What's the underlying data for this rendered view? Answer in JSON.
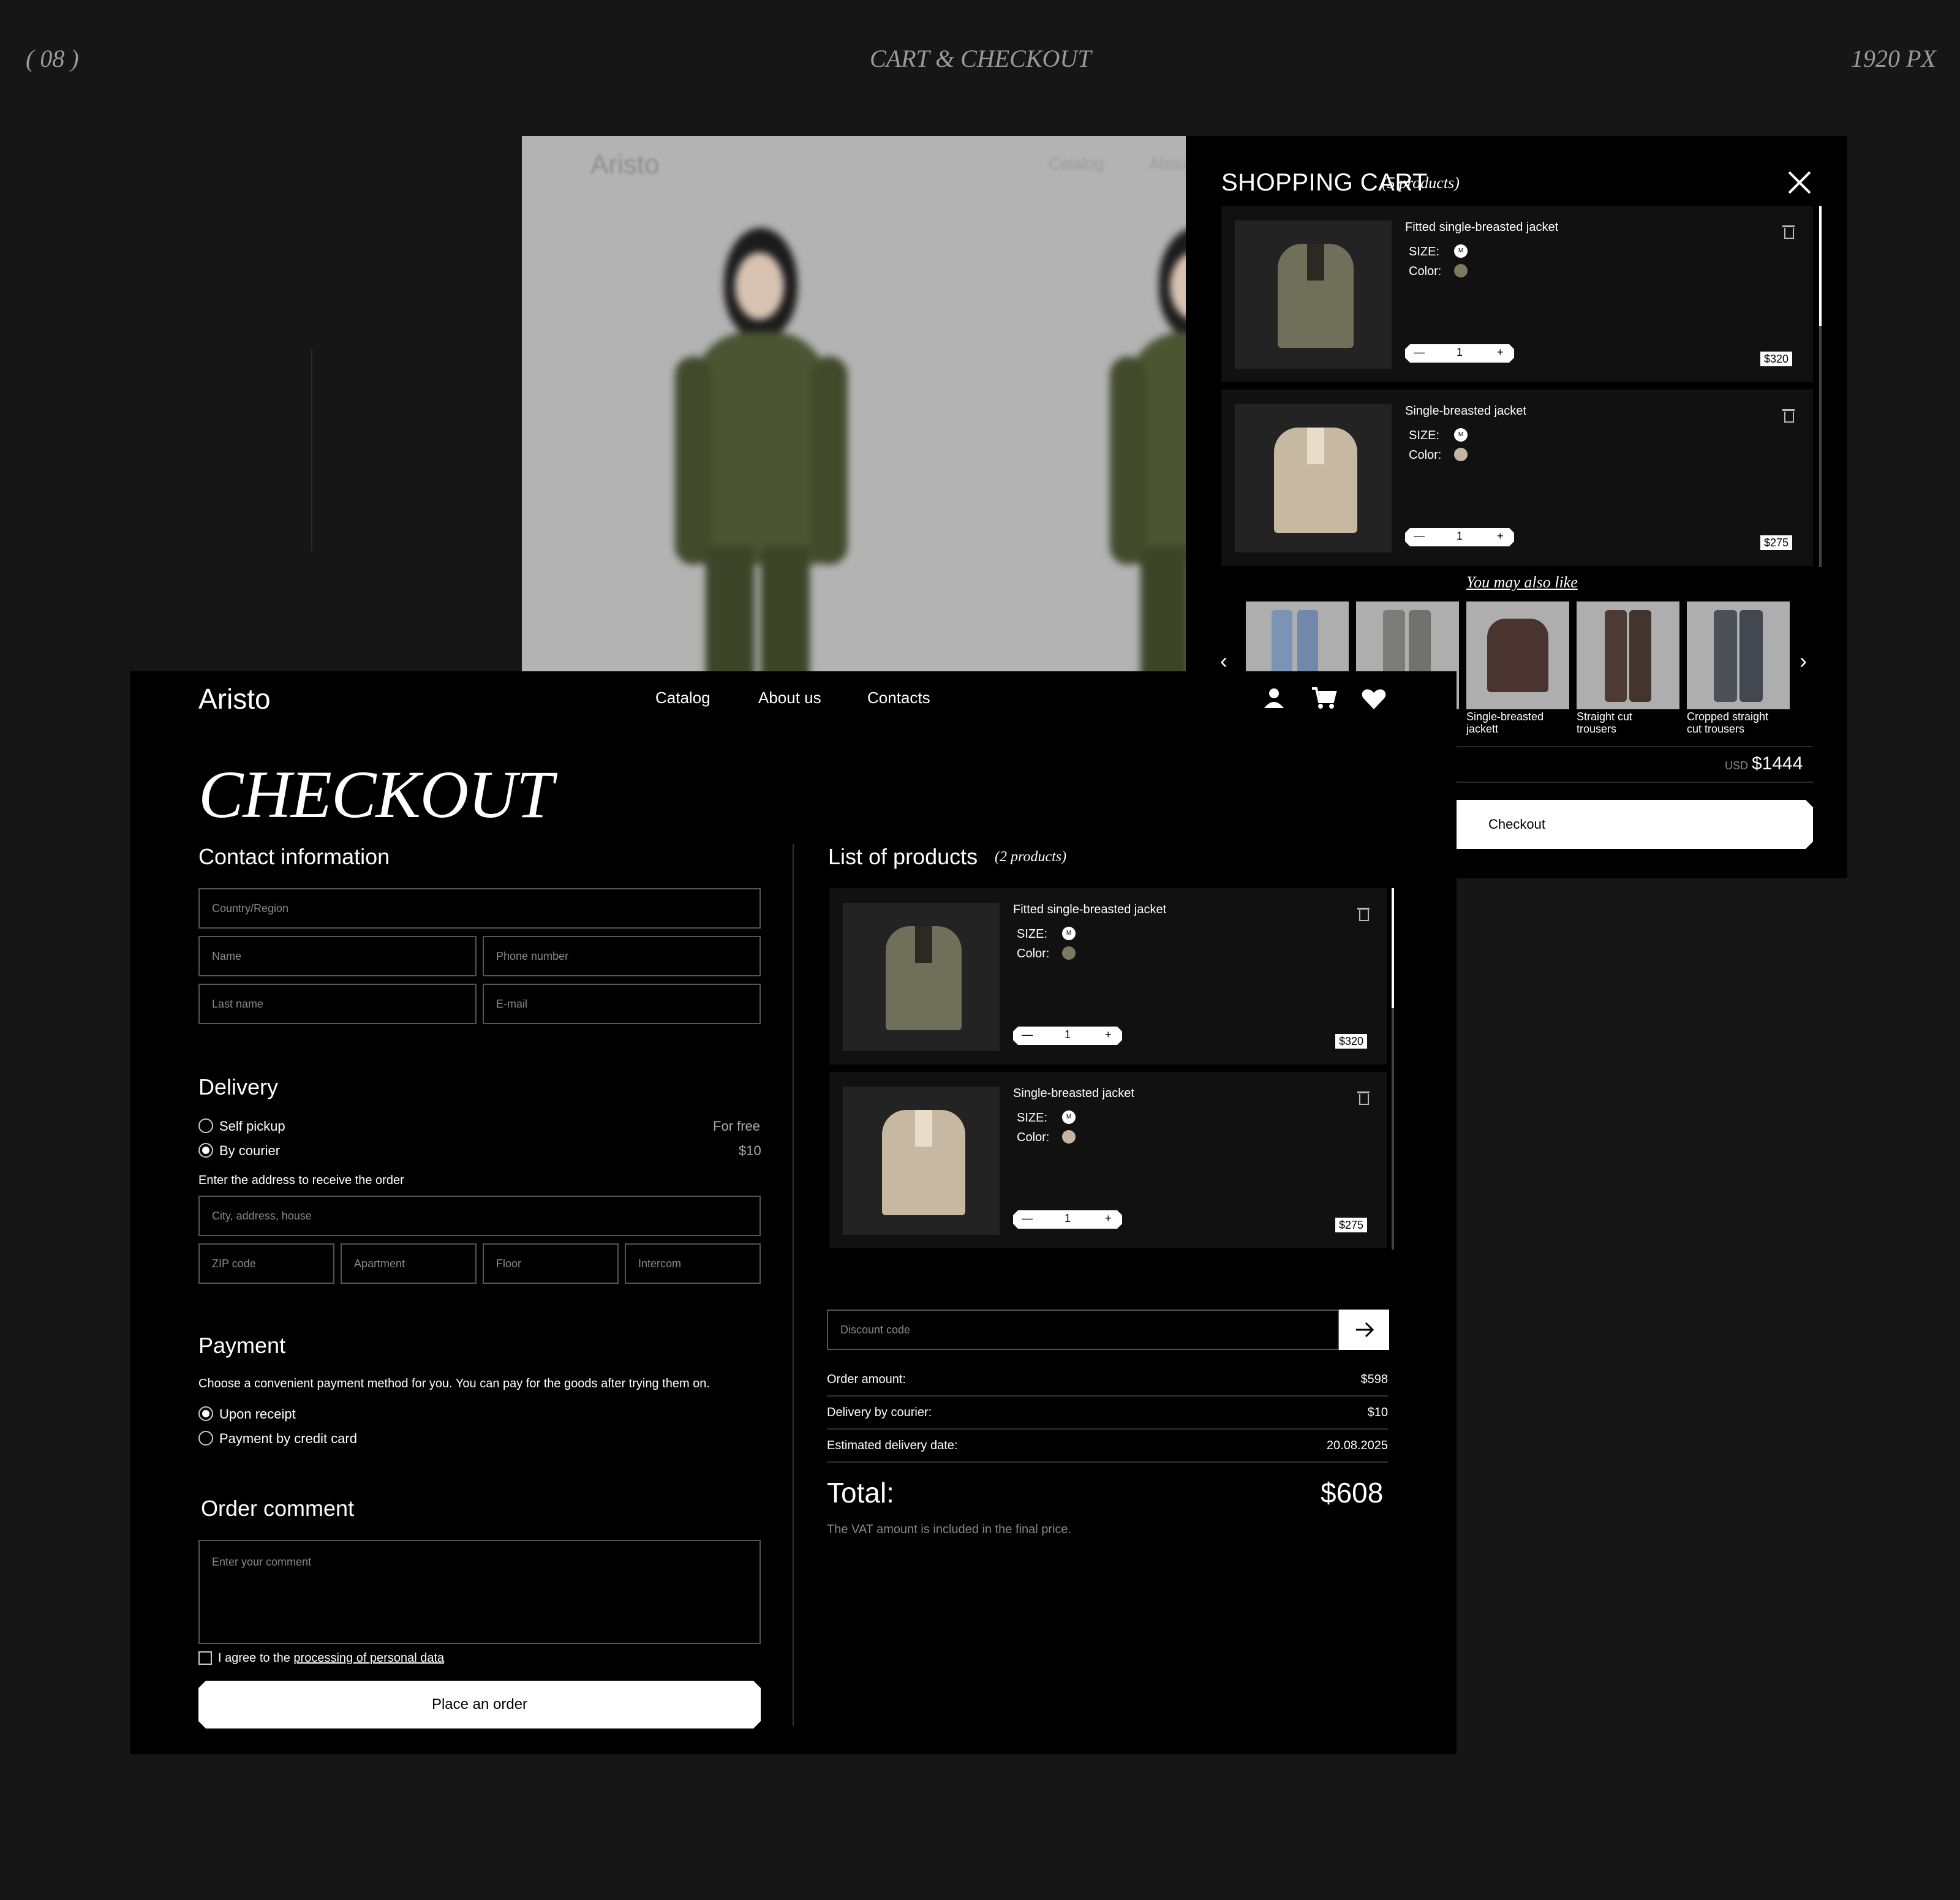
{
  "header": {
    "index": "( 08 )",
    "title": "CART & CHECKOUT",
    "size": "1920 PX"
  },
  "hero": {
    "logo": "Aristo",
    "nav": [
      "Catalog",
      "About"
    ]
  },
  "cart": {
    "title": "SHOPPING CART",
    "count": "(5 products)",
    "items": [
      {
        "name": "Fitted single-breasted jacket",
        "size_label": "SIZE:",
        "size": "M",
        "color_label": "Color:",
        "color": "#7a7a60",
        "qty": "1",
        "minus": "—",
        "plus": "+",
        "price": "$320"
      },
      {
        "name": "Single-breasted jacket",
        "size_label": "SIZE:",
        "size": "M",
        "color_label": "Color:",
        "color": "#c4b5a0",
        "qty": "1",
        "minus": "—",
        "plus": "+",
        "price": "$275"
      }
    ],
    "also_like": "You may also like",
    "recommendations": [
      {
        "label": "",
        "color": "#7b93b5"
      },
      {
        "label": "",
        "color": "#7c7c78"
      },
      {
        "label": "Single-breasted jackett",
        "color": "#4a3430"
      },
      {
        "label": "Straight cut trousers",
        "color": "#4d3c34"
      },
      {
        "label": "Cropped straight cut trousers",
        "color": "#4c5058"
      }
    ],
    "currency": "USD",
    "total": "$1444",
    "checkout_label": "Checkout"
  },
  "page": {
    "logo": "Aristo",
    "nav": {
      "catalog": "Catalog",
      "about": "About us",
      "contacts": "Contacts"
    },
    "icons": [
      "user-icon",
      "cart-icon",
      "heart-icon"
    ],
    "title": "CHECKOUT"
  },
  "contact": {
    "heading": "Contact information",
    "country": "Country/Region",
    "name": "Name",
    "phone": "Phone number",
    "last_name": "Last name",
    "email": "E-mail"
  },
  "delivery": {
    "heading": "Delivery",
    "options": [
      {
        "label": "Self pickup",
        "price": "For free",
        "selected": false
      },
      {
        "label": "By courier",
        "price": "$10",
        "selected": true
      }
    ],
    "address_hint": "Enter the address to receive the order",
    "city": "City, address, house",
    "zip": "ZIP code",
    "apartment": "Apartment",
    "floor": "Floor",
    "intercom": "Intercom"
  },
  "payment": {
    "heading": "Payment",
    "hint": "Choose a convenient payment method for you. You can pay for the goods after trying them on.",
    "options": [
      {
        "label": "Upon receipt",
        "selected": true
      },
      {
        "label": "Payment by credit card",
        "selected": false
      }
    ]
  },
  "comment": {
    "heading": "Order comment",
    "placeholder": "Enter your comment",
    "agree_prefix": "I agree to the ",
    "agree_link": "processing of personal data",
    "place_order": "Place an order"
  },
  "products": {
    "heading": "List of products",
    "count": "(2 products)",
    "items": [
      {
        "name": "Fitted single-breasted jacket",
        "size_label": "SIZE:",
        "size": "M",
        "color_label": "Color:",
        "color": "#7a7a60",
        "qty": "1",
        "minus": "—",
        "plus": "+",
        "price": "$320"
      },
      {
        "name": "Single-breasted jacket",
        "size_label": "SIZE:",
        "size": "M",
        "color_label": "Color:",
        "color": "#c4b5a0",
        "qty": "1",
        "minus": "—",
        "plus": "+",
        "price": "$275"
      }
    ]
  },
  "summary": {
    "discount_placeholder": "Discount code",
    "rows": [
      {
        "label": "Order amount:",
        "value": "$598"
      },
      {
        "label": "Delivery by courier:",
        "value": "$10"
      },
      {
        "label": "Estimated delivery date:",
        "value": "20.08.2025"
      }
    ],
    "total_label": "Total:",
    "total_value": "$608",
    "vat_note": "The VAT amount is included in the final price."
  }
}
